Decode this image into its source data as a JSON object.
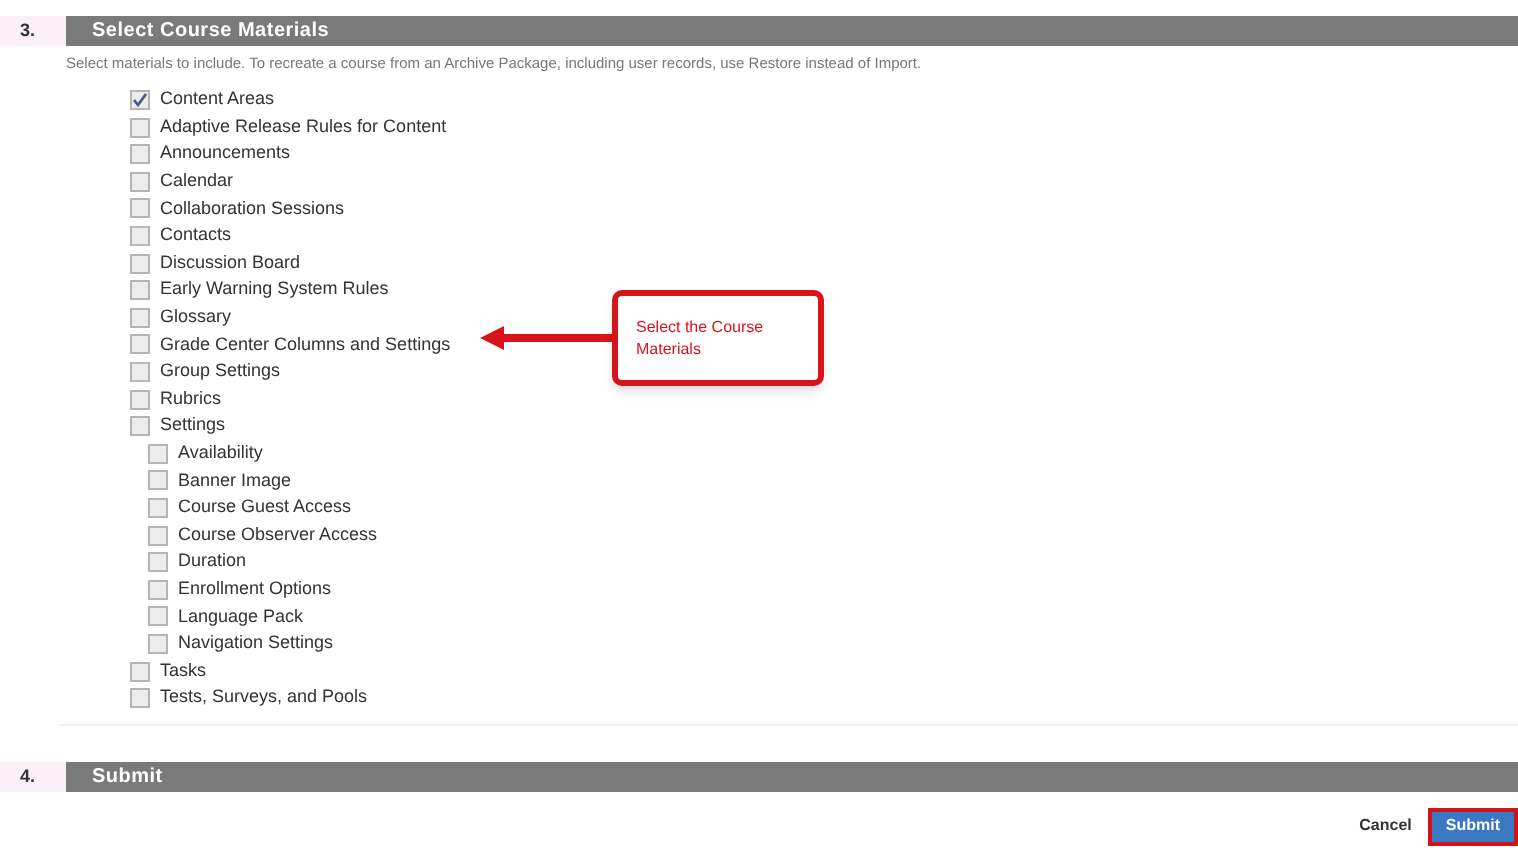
{
  "sections": [
    {
      "number": "3.",
      "title": "Select Course Materials",
      "description": "Select materials to include. To recreate a course from an Archive Package, including user records, use Restore instead of Import.",
      "items": [
        {
          "label": "Content Areas",
          "checked": true
        },
        {
          "label": "Adaptive Release Rules for Content",
          "checked": false
        },
        {
          "label": "Announcements",
          "checked": false
        },
        {
          "label": "Calendar",
          "checked": false
        },
        {
          "label": "Collaboration Sessions",
          "checked": false
        },
        {
          "label": "Contacts",
          "checked": false
        },
        {
          "label": "Discussion Board",
          "checked": false
        },
        {
          "label": "Early Warning System Rules",
          "checked": false
        },
        {
          "label": "Glossary",
          "checked": false
        },
        {
          "label": "Grade Center Columns and Settings",
          "checked": false
        },
        {
          "label": "Group Settings",
          "checked": false
        },
        {
          "label": "Rubrics",
          "checked": false
        },
        {
          "label": "Settings",
          "checked": false,
          "children": [
            {
              "label": "Availability",
              "checked": false
            },
            {
              "label": "Banner Image",
              "checked": false
            },
            {
              "label": "Course Guest Access",
              "checked": false
            },
            {
              "label": "Course Observer Access",
              "checked": false
            },
            {
              "label": "Duration",
              "checked": false
            },
            {
              "label": "Enrollment Options",
              "checked": false
            },
            {
              "label": "Language Pack",
              "checked": false
            },
            {
              "label": "Navigation Settings",
              "checked": false
            }
          ]
        },
        {
          "label": "Tasks",
          "checked": false
        },
        {
          "label": "Tests, Surveys, and Pools",
          "checked": false
        }
      ]
    },
    {
      "number": "4.",
      "title": "Submit"
    }
  ],
  "callout": {
    "text": "Select the Course Materials"
  },
  "buttons": [
    {
      "label": "Cancel",
      "kind": "secondary",
      "highlighted": false
    },
    {
      "label": "Submit",
      "kind": "primary",
      "highlighted": true
    }
  ]
}
